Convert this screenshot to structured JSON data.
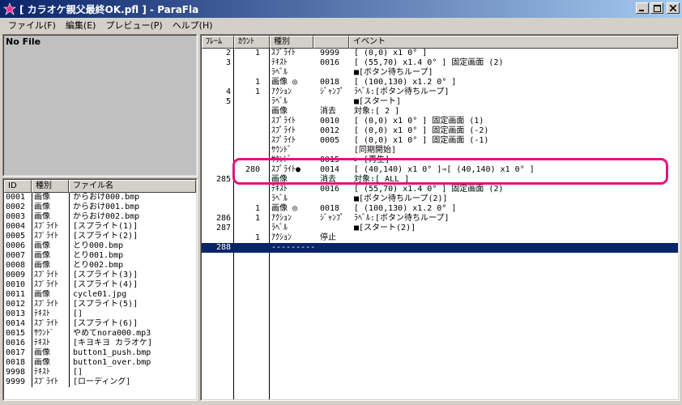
{
  "window": {
    "title": "[ カラオケ親父最終OK.pfl ] - ParaFla",
    "minimize_label": "_",
    "maximize_label": "□",
    "close_label": "×"
  },
  "menu": {
    "items": [
      {
        "label": "ファイル(F)"
      },
      {
        "label": "編集(E)"
      },
      {
        "label": "プレビュー(P)"
      },
      {
        "label": "ヘルプ(H)"
      }
    ]
  },
  "preview": {
    "status": "No File"
  },
  "files": {
    "headers": {
      "id": "ID",
      "type": "種別",
      "name": "ファイル名"
    },
    "rows": [
      {
        "id": "0001",
        "type": "画像",
        "name": "からおけ000.bmp"
      },
      {
        "id": "0002",
        "type": "画像",
        "name": "からおけ001.bmp"
      },
      {
        "id": "0003",
        "type": "画像",
        "name": "からおけ002.bmp"
      },
      {
        "id": "0004",
        "type": "ｽﾌﾟﾗｲﾄ",
        "name": "[スプライト(1)]"
      },
      {
        "id": "0005",
        "type": "ｽﾌﾟﾗｲﾄ",
        "name": "[スプライト(2)]"
      },
      {
        "id": "0006",
        "type": "画像",
        "name": "とり000.bmp"
      },
      {
        "id": "0007",
        "type": "画像",
        "name": "とり001.bmp"
      },
      {
        "id": "0008",
        "type": "画像",
        "name": "とり002.bmp"
      },
      {
        "id": "0009",
        "type": "ｽﾌﾟﾗｲﾄ",
        "name": "[スプライト(3)]"
      },
      {
        "id": "0010",
        "type": "ｽﾌﾟﾗｲﾄ",
        "name": "[スプライト(4)]"
      },
      {
        "id": "0011",
        "type": "画像",
        "name": "cycle01.jpg"
      },
      {
        "id": "0012",
        "type": "ｽﾌﾟﾗｲﾄ",
        "name": "[スプライト(5)]"
      },
      {
        "id": "0013",
        "type": "ﾃｷｽﾄ",
        "name": "[]"
      },
      {
        "id": "0014",
        "type": "ｽﾌﾟﾗｲﾄ",
        "name": "[スプライト(6)]"
      },
      {
        "id": "0015",
        "type": "ｻｳﾝﾄﾞ",
        "name": "やめてnora000.mp3"
      },
      {
        "id": "0016",
        "type": "ﾃｷｽﾄ",
        "name": "[キヨキヨ カラオケ]"
      },
      {
        "id": "0017",
        "type": "画像",
        "name": "button1_push.bmp"
      },
      {
        "id": "0018",
        "type": "画像",
        "name": "button1_over.bmp"
      },
      {
        "id": "9998",
        "type": "ﾃｷｽﾄ",
        "name": "[]"
      },
      {
        "id": "9999",
        "type": "ｽﾌﾟﾗｲﾄ",
        "name": "[ローディング]"
      }
    ]
  },
  "events": {
    "headers": {
      "frame": "ﾌﾚｰﾑ",
      "count": "ｶｳﾝﾄ",
      "type": "種別",
      "code": "",
      "event": "イベント"
    },
    "rows": [
      {
        "frame": "2",
        "count": "1",
        "type": "ｽﾌﾟﾗｲﾄ",
        "code": "9999",
        "event": "[      (0,0)        x1     0° ]"
      },
      {
        "frame": "3",
        "count": "",
        "type": "ﾃｷｽﾄ",
        "code": "0016",
        "event": "[   (55,70)    x1.4    0° ] 固定画面 (2)"
      },
      {
        "frame": "",
        "count": "",
        "type": "ﾗﾍﾞﾙ",
        "code": "",
        "event": "■[ボタン待ちループ]"
      },
      {
        "frame": "",
        "count": "1",
        "type": "画像  ◎",
        "code": "0018",
        "event": "[  (100,130)    x1.2    0° ]"
      },
      {
        "frame": "4",
        "count": "1",
        "type": "ｱｸｼｮﾝ",
        "code": "ｼﾞｬﾝﾌﾟ",
        "event": "ﾗﾍﾞﾙ:[ボタン待ちループ]"
      },
      {
        "frame": "5",
        "count": "",
        "type": "ﾗﾍﾞﾙ",
        "code": "",
        "event": "■[スタート]"
      },
      {
        "frame": "",
        "count": "",
        "type": "画像",
        "code": "消去",
        "event": "対象:[ 2 ]"
      },
      {
        "frame": "",
        "count": "",
        "type": "ｽﾌﾟﾗｲﾄ",
        "code": "0010",
        "event": "[      (0,0)        x1     0° ] 固定画面 (1)"
      },
      {
        "frame": "",
        "count": "",
        "type": "ｽﾌﾟﾗｲﾄ",
        "code": "0012",
        "event": "[      (0,0)        x1     0° ] 固定画面 (-2)"
      },
      {
        "frame": "",
        "count": "",
        "type": "ｽﾌﾟﾗｲﾄ",
        "code": "0005",
        "event": "[      (0,0)        x1     0° ] 固定画面 (-1)"
      },
      {
        "frame": "",
        "count": "",
        "type": "ｻｳﾝﾄﾞ",
        "code": "",
        "event": "[同期開始]"
      },
      {
        "frame": "",
        "count": "",
        "type": "ｻｳﾝﾄﾞ",
        "code": "0015",
        "event": "> [再生]"
      },
      {
        "frame": "",
        "count": "280",
        "type": "ｽﾌﾟﾗｲﾄ●",
        "code": "0014",
        "event": "[   (40,140)       x1     0° ]⇒[    (40,140)        x1     0° ]"
      },
      {
        "frame": "285",
        "count": "",
        "type": "画像",
        "code": "消去",
        "event": "対象:[ ALL ]"
      },
      {
        "frame": "",
        "count": "",
        "type": "ﾃｷｽﾄ",
        "code": "0016",
        "event": "[   (55,70)    x1.4    0° ] 固定画面 (2)"
      },
      {
        "frame": "",
        "count": "",
        "type": "ﾗﾍﾞﾙ",
        "code": "",
        "event": "■[ボタン待ちループ(2)]"
      },
      {
        "frame": "",
        "count": "1",
        "type": "画像  ◎",
        "code": "0018",
        "event": "[  (100,130)    x1.2    0° ]"
      },
      {
        "frame": "286",
        "count": "1",
        "type": "ｱｸｼｮﾝ",
        "code": "ｼﾞｬﾝﾌﾟ",
        "event": "ﾗﾍﾞﾙ:[ボタン待ちループ]"
      },
      {
        "frame": "287",
        "count": "",
        "type": "ﾗﾍﾞﾙ",
        "code": "",
        "event": "■[スタート(2)]"
      },
      {
        "frame": "",
        "count": "1",
        "type": "ｱｸｼｮﾝ",
        "code": "停止",
        "event": ""
      },
      {
        "frame": "288",
        "count": "",
        "type": "---------",
        "code": "",
        "event": "",
        "selected": true
      }
    ]
  },
  "colors": {
    "title_bar": "#0a246a",
    "selection": "#0a246a",
    "highlight_ring": "#e0157d"
  }
}
